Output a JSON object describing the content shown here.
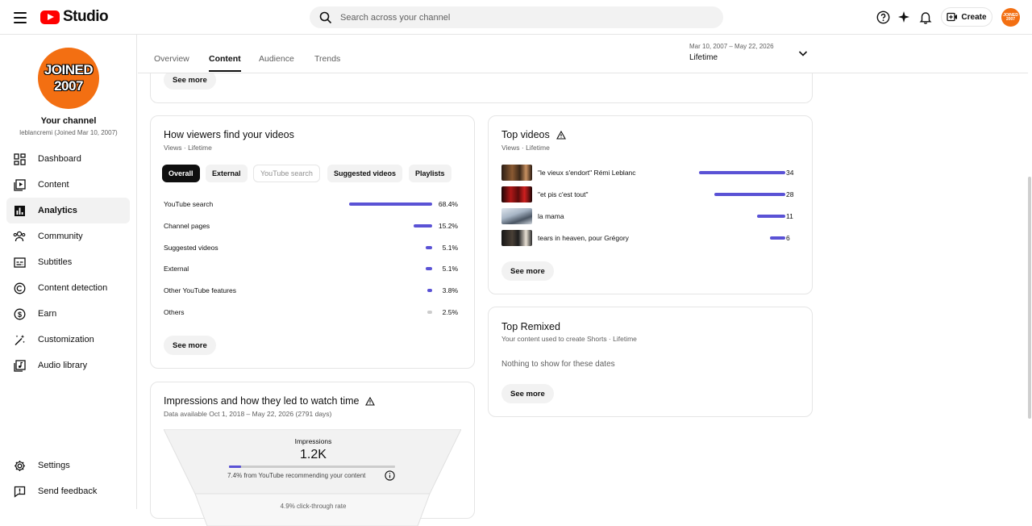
{
  "header": {
    "logo_text": "Studio",
    "search_placeholder": "Search across your channel",
    "create_label": "Create",
    "avatar_text": "JOINED 2007",
    "icons": [
      "menu-icon",
      "help-icon",
      "sparkle-icon",
      "bell-icon",
      "video-add-icon"
    ]
  },
  "sidebar": {
    "avatar_line1": "JOINED",
    "avatar_line2": "2007",
    "channel_title": "Your channel",
    "channel_sub": "leblancremi (Joined Mar 10, 2007)",
    "items": [
      {
        "label": "Dashboard",
        "icon": "dashboard-icon"
      },
      {
        "label": "Content",
        "icon": "content-icon"
      },
      {
        "label": "Analytics",
        "icon": "analytics-icon",
        "active": true
      },
      {
        "label": "Community",
        "icon": "community-icon"
      },
      {
        "label": "Subtitles",
        "icon": "subtitles-icon"
      },
      {
        "label": "Content detection",
        "icon": "copyright-icon"
      },
      {
        "label": "Earn",
        "icon": "earn-icon"
      },
      {
        "label": "Customization",
        "icon": "customization-icon"
      },
      {
        "label": "Audio library",
        "icon": "audio-library-icon"
      }
    ],
    "bottom_items": [
      {
        "label": "Settings",
        "icon": "settings-icon"
      },
      {
        "label": "Send feedback",
        "icon": "feedback-icon"
      }
    ]
  },
  "tabs": {
    "items": [
      "Overview",
      "Content",
      "Audience",
      "Trends"
    ],
    "active": "Content",
    "date_range": "Mar 10, 2007 – May 22, 2026",
    "date_value": "Lifetime"
  },
  "top_card": {
    "see_more": "See more"
  },
  "traffic": {
    "title": "How viewers find your videos",
    "subtitle": "Views · Lifetime",
    "chips": [
      "Overall",
      "External",
      "YouTube search",
      "Suggested videos",
      "Playlists"
    ],
    "rows": [
      {
        "label": "YouTube search",
        "pct": "68.4%",
        "value": 68.4
      },
      {
        "label": "Channel pages",
        "pct": "15.2%",
        "value": 15.2
      },
      {
        "label": "Suggested videos",
        "pct": "5.1%",
        "value": 5.1
      },
      {
        "label": "External",
        "pct": "5.1%",
        "value": 5.1
      },
      {
        "label": "Other YouTube features",
        "pct": "3.8%",
        "value": 3.8
      },
      {
        "label": "Others",
        "pct": "2.5%",
        "value": 2.5
      }
    ],
    "see_more": "See more"
  },
  "impressions": {
    "title": "Impressions and how they led to watch time",
    "subtitle": "Data available Oct 1, 2018 – May 22, 2026 (2791 days)",
    "label": "Impressions",
    "value": "1.2K",
    "recommend_text": "7.4% from YouTube recommending your content",
    "recommend_pct": 7.4,
    "ctr_text": "4.9% click-through rate"
  },
  "top_videos": {
    "title": "Top videos",
    "subtitle": "Views · Lifetime",
    "rows": [
      {
        "title": "\"le vieux s'endort\" Rémi Leblanc",
        "views": "34",
        "value": 34
      },
      {
        "title": "\"et pis c'est tout\"",
        "views": "28",
        "value": 28
      },
      {
        "title": "la mama",
        "views": "11",
        "value": 11
      },
      {
        "title": "tears in heaven, pour Grégory",
        "views": "6",
        "value": 6
      }
    ],
    "see_more": "See more"
  },
  "top_remixed": {
    "title": "Top Remixed",
    "subtitle": "Your content used to create Shorts · Lifetime",
    "empty": "Nothing to show for these dates",
    "see_more": "See more"
  },
  "colors": {
    "accent": "#5a52d5",
    "brand": "#ff0000",
    "avatar": "#f36f12"
  }
}
